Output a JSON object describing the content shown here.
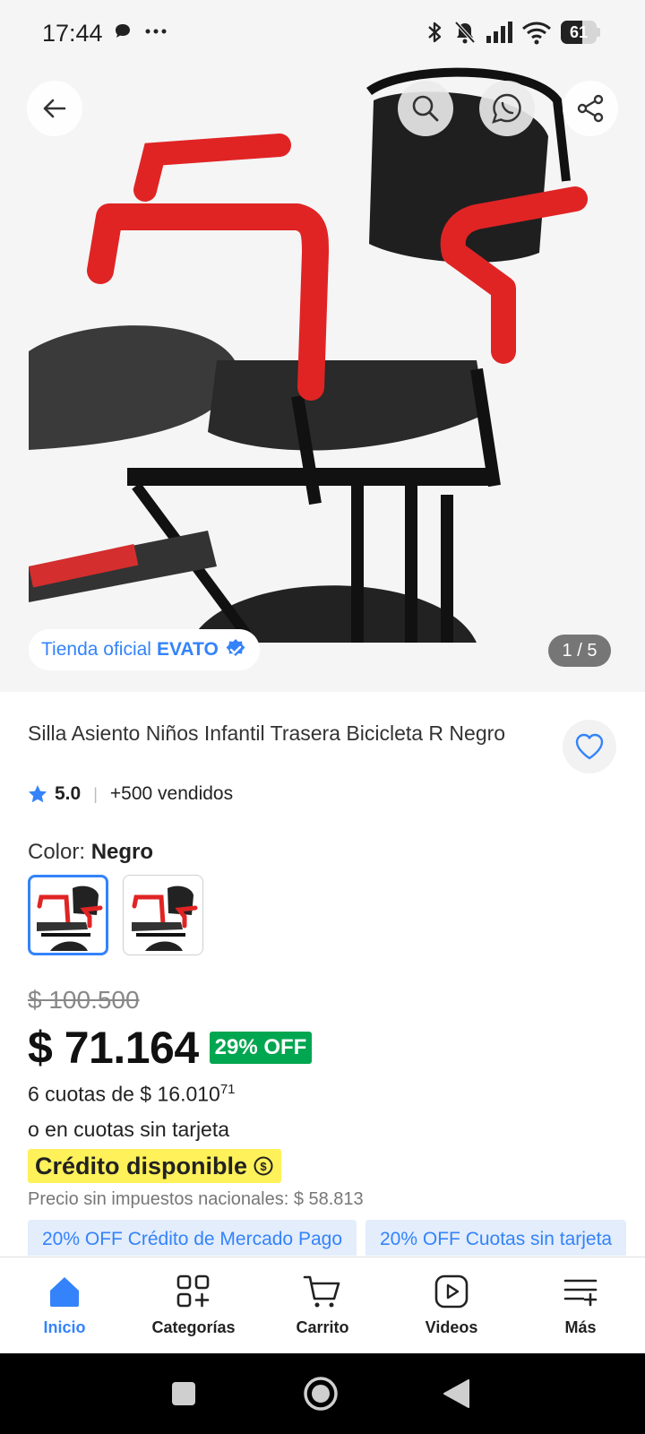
{
  "status_bar": {
    "time": "17:44",
    "left_icons": [
      "chat-bubble-icon",
      "more-dots-icon"
    ],
    "right_icons": [
      "bluetooth-icon",
      "bell-muted-icon",
      "signal-icon",
      "wifi-icon"
    ],
    "battery_level": "61"
  },
  "gallery": {
    "official_store_prefix": "Tienda oficial",
    "official_store_name": "EVATO",
    "counter": "1 / 5",
    "buttons": [
      "back-icon",
      "search-icon",
      "whatsapp-icon",
      "share-icon"
    ]
  },
  "product": {
    "title": "Silla Asiento Niños Infantil Trasera Bicicleta R Negro",
    "rating": "5.0",
    "sold": "+500 vendidos",
    "color_label": "Color:",
    "color_value": "Negro",
    "old_price": "$ 100.500",
    "price": "$ 71.164",
    "discount": "29% OFF",
    "installments_prefix": "6 cuotas de $ 16.010",
    "installments_cents": "71",
    "installments_alt": "o en cuotas sin tarjeta",
    "credit_badge": "Crédito disponible",
    "tax_note": "Precio sin impuestos nacionales: $ 58.813",
    "promos": [
      "20% OFF Crédito de Mercado Pago",
      "20% OFF Cuotas sin tarjeta"
    ]
  },
  "bottom_nav": [
    {
      "label": "Inicio",
      "icon": "home-icon",
      "active": true
    },
    {
      "label": "Categorías",
      "icon": "categories-icon",
      "active": false
    },
    {
      "label": "Carrito",
      "icon": "cart-icon",
      "active": false
    },
    {
      "label": "Videos",
      "icon": "play-icon",
      "active": false
    },
    {
      "label": "Más",
      "icon": "menu-plus-icon",
      "active": false
    }
  ],
  "colors": {
    "accent": "#3483fa",
    "discount_green": "#00a650",
    "credit_yellow": "#fff159"
  }
}
